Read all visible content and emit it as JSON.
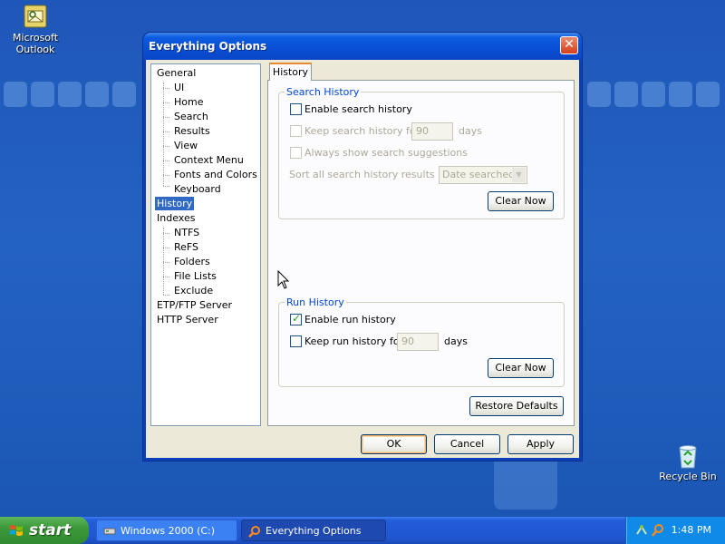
{
  "desktop": {
    "icons": [
      {
        "name": "outlook",
        "label": "Microsoft Outlook"
      },
      {
        "name": "recycle-bin",
        "label": "Recycle Bin"
      }
    ]
  },
  "window": {
    "title": "Everything Options",
    "close_symbol": "✕"
  },
  "tree": {
    "items": [
      "General",
      "UI",
      "Home",
      "Search",
      "Results",
      "View",
      "Context Menu",
      "Fonts and Colors",
      "Keyboard",
      "History",
      "Indexes",
      "NTFS",
      "ReFS",
      "Folders",
      "File Lists",
      "Exclude",
      "ETP/FTP Server",
      "HTTP Server"
    ],
    "selected": "History"
  },
  "tab": {
    "label": "History"
  },
  "search_history": {
    "legend": "Search History",
    "enable_label": "Enable search history",
    "enable_checked": false,
    "keep_label": "Keep search history for",
    "keep_value": "90",
    "keep_unit": "days",
    "suggestions_label": "Always show search suggestions",
    "sort_label": "Sort all search history results by:",
    "sort_value": "Date searched",
    "clear_label": "Clear Now"
  },
  "run_history": {
    "legend": "Run History",
    "enable_label": "Enable run history",
    "enable_checked": true,
    "keep_label": "Keep run history for",
    "keep_value": "90",
    "keep_unit": "days",
    "clear_label": "Clear Now"
  },
  "buttons": {
    "restore": "Restore Defaults",
    "ok": "OK",
    "cancel": "Cancel",
    "apply": "Apply"
  },
  "taskbar": {
    "start": "start",
    "tasks": [
      "Windows 2000 (C:)",
      "Everything Options"
    ],
    "clock": "1:48 PM"
  },
  "colors": {
    "desktop": "#2462c2",
    "titlebar": "#0a4fd6",
    "selection": "#316ac5",
    "legend": "#0046d5",
    "start": "#3c9a3a"
  }
}
